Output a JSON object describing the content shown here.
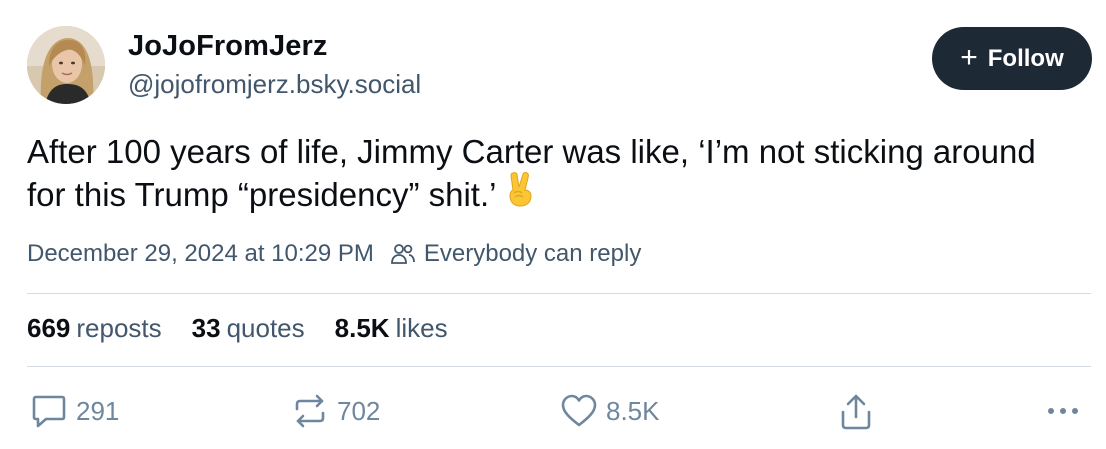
{
  "author": {
    "display_name": "JoJoFromJerz",
    "handle": "@jojofromjerz.bsky.social"
  },
  "follow_button": {
    "icon": "+",
    "label": "Follow"
  },
  "post": {
    "text": "After 100 years of life, Jimmy Carter was like, ‘I’m not sticking around for this Trump “presidency” shit.’",
    "emoji": "victory-hand-emoji",
    "timestamp": "December 29, 2024 at 10:29 PM",
    "reply_setting": "Everybody can reply"
  },
  "stats": {
    "reposts_count": "669",
    "reposts_label": "reposts",
    "quotes_count": "33",
    "quotes_label": "quotes",
    "likes_count": "8.5K",
    "likes_label": "likes"
  },
  "actions": {
    "reply_count": "291",
    "repost_count": "702",
    "like_count": "8.5K"
  },
  "colors": {
    "follow_button_bg": "#1e2936",
    "muted_text": "#42576c",
    "action_icon": "#6f869f",
    "divider": "#d4dbe2"
  }
}
